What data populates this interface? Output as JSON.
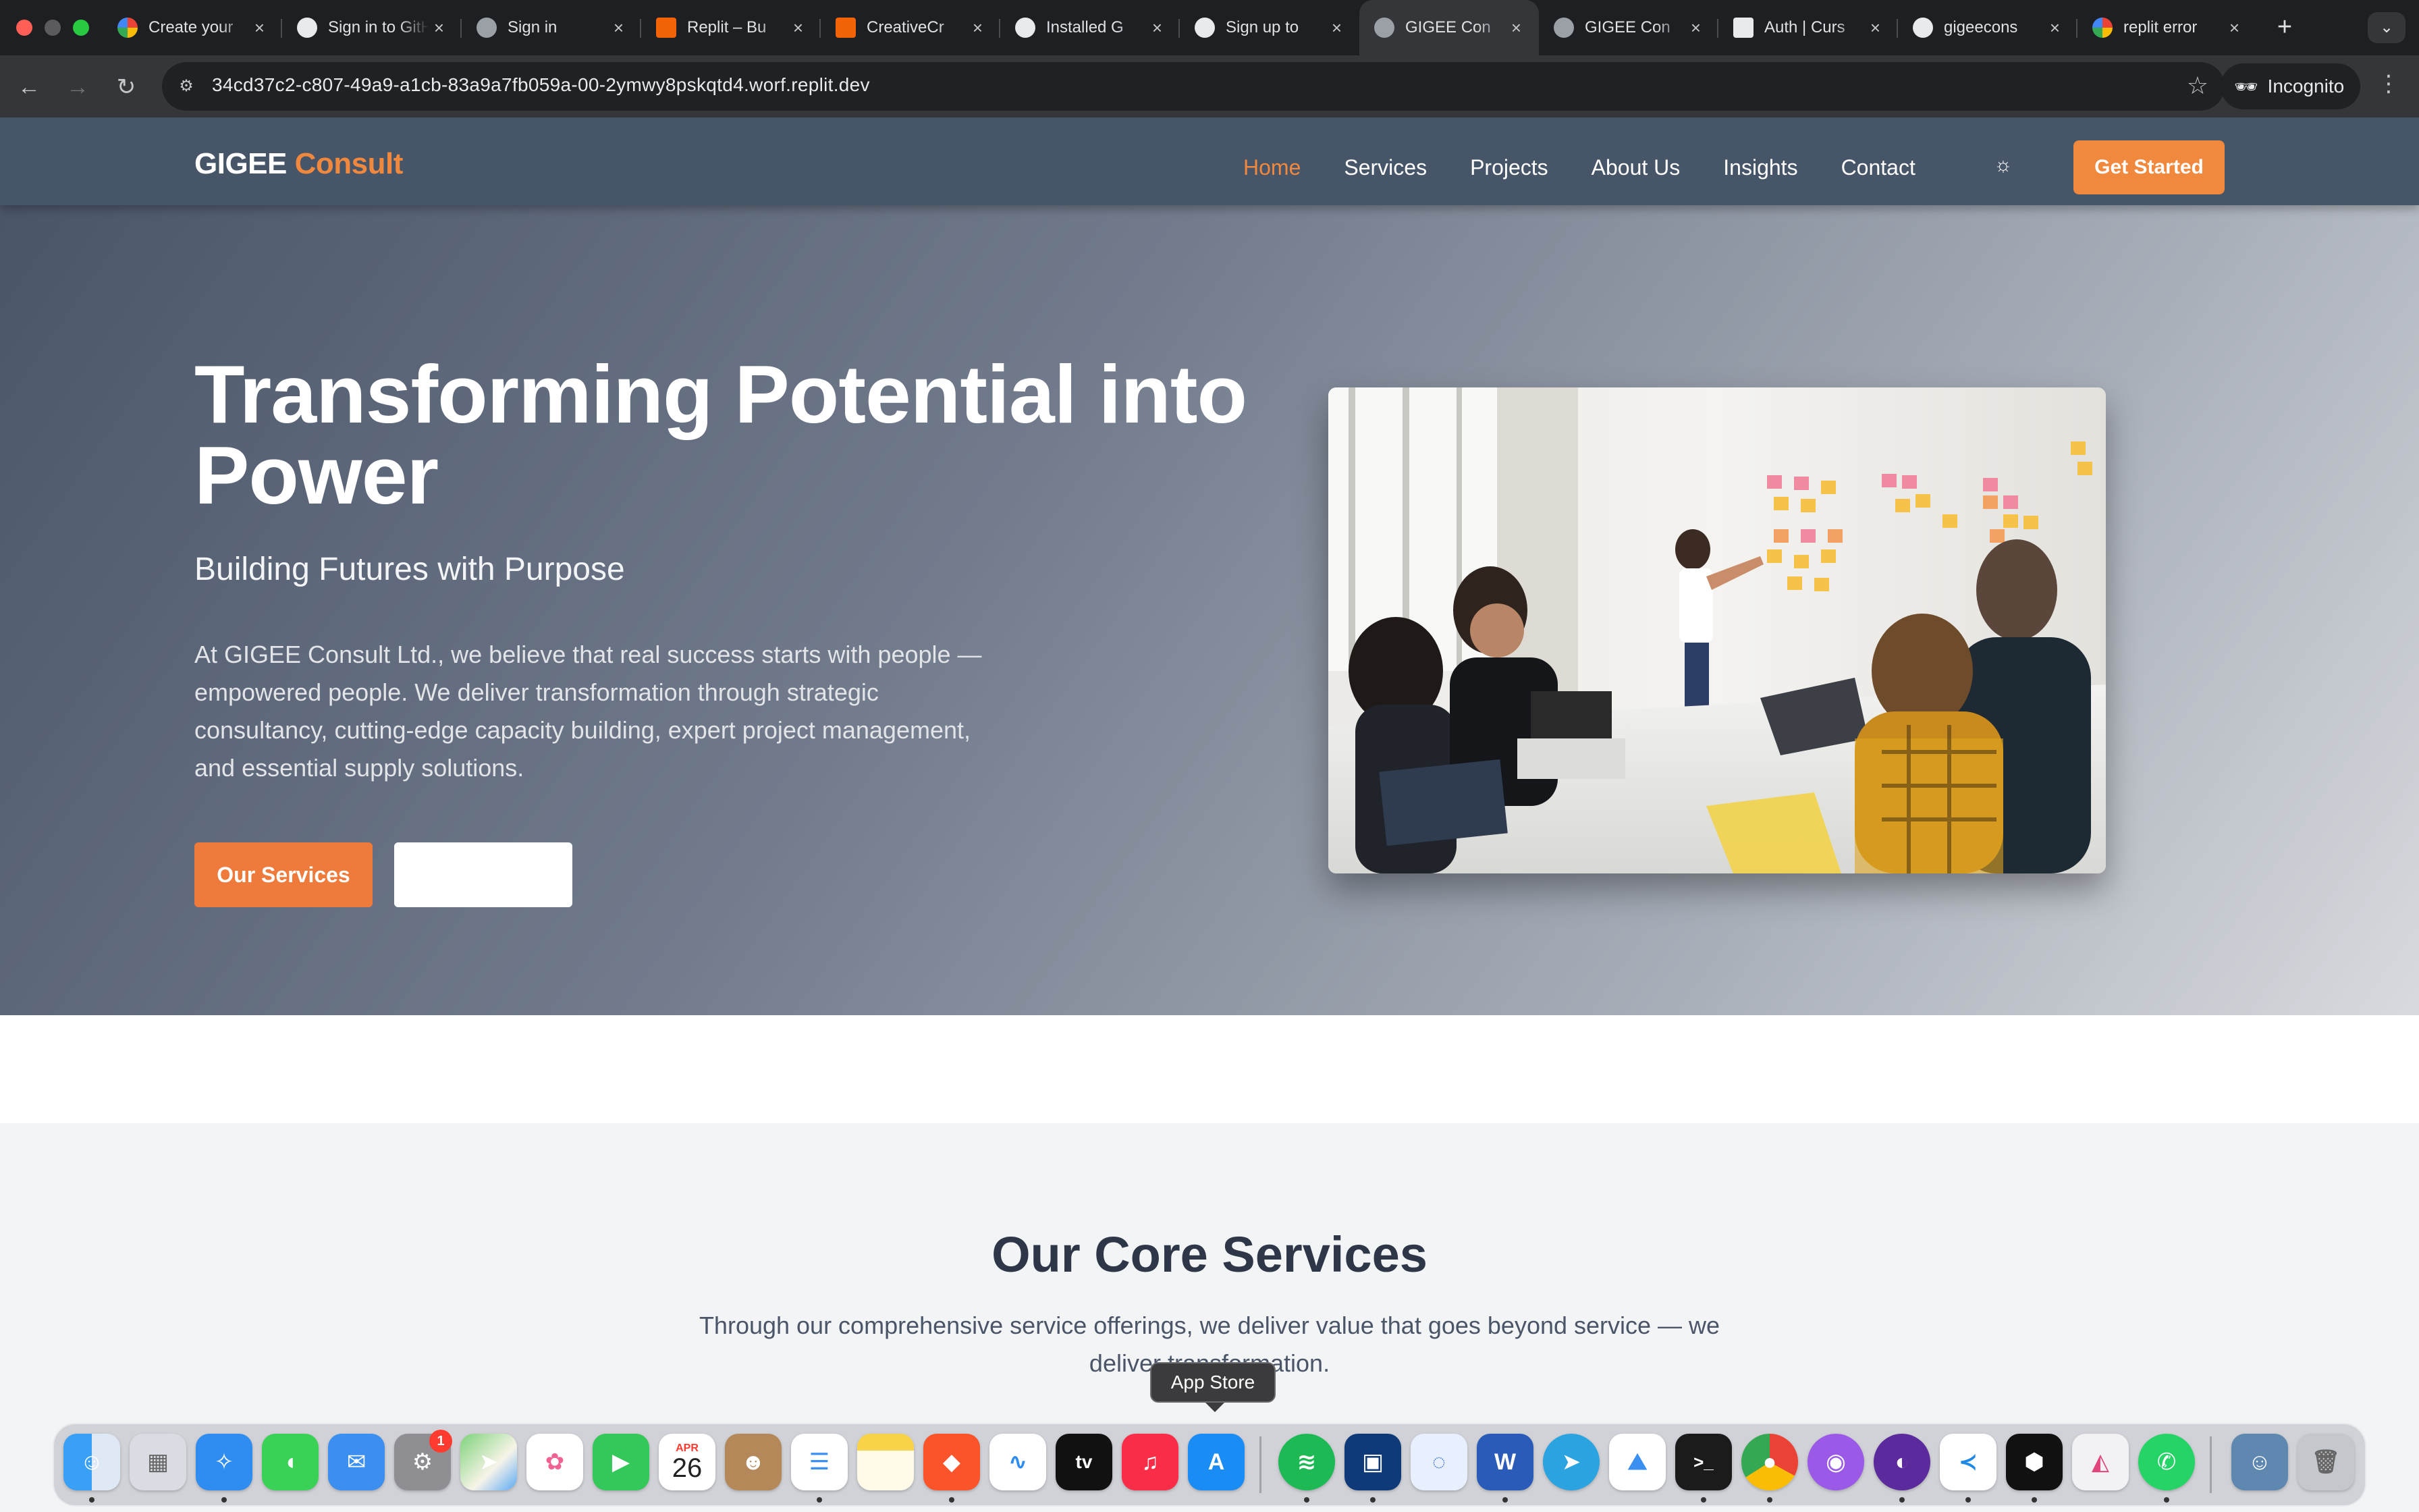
{
  "browser": {
    "tabs": [
      {
        "title": "Create your",
        "favicon": "google-icon"
      },
      {
        "title": "Sign in to GitHub",
        "favicon": "github-icon"
      },
      {
        "title": "Sign in",
        "favicon": "globe-icon"
      },
      {
        "title": "Replit – Bu",
        "favicon": "replit-icon"
      },
      {
        "title": "CreativeCr",
        "favicon": "replit-icon"
      },
      {
        "title": "Installed G",
        "favicon": "github-icon"
      },
      {
        "title": "Sign up to",
        "favicon": "github-icon"
      },
      {
        "title": "GIGEE Con",
        "favicon": "globe-icon",
        "active": true
      },
      {
        "title": "GIGEE Con",
        "favicon": "globe-icon"
      },
      {
        "title": "Auth | Curs",
        "favicon": "cursor-icon"
      },
      {
        "title": "gigeecons",
        "favicon": "github-icon"
      },
      {
        "title": "replit error",
        "favicon": "google-icon"
      }
    ],
    "url": "34cd37c2-c807-49a9-a1cb-83a9a7fb059a-00-2ymwy8pskqtd4.worf.replit.dev",
    "profile_label": "Incognito"
  },
  "site": {
    "logo_main": "GIGEE",
    "logo_accent": "Consult",
    "nav": [
      "Home",
      "Services",
      "Projects",
      "About Us",
      "Insights",
      "Contact"
    ],
    "active_nav": "Home",
    "cta": "Get Started",
    "hero": {
      "title": "Transforming Potential into Power",
      "subtitle": "Building Futures with Purpose",
      "description": "At GIGEE Consult Ltd., we believe that real success starts with people — empowered people. We deliver transformation through strategic consultancy, cutting-edge capacity building, expert project management, and essential supply solutions.",
      "primary_button": "Our Services",
      "secondary_button": ""
    },
    "core": {
      "title": "Our Core Services",
      "description": "Through our comprehensive service offerings, we deliver value that goes beyond service — we deliver transformation."
    },
    "colors": {
      "accent": "#f0883e",
      "nav_bg": "#475569",
      "heading": "#2d3748"
    }
  },
  "dock": {
    "tooltip": "App Store",
    "calendar_month": "APR",
    "calendar_day": "26",
    "settings_badge": "1",
    "apps": [
      "finder",
      "launchpad",
      "safari",
      "messages",
      "mail",
      "system-settings",
      "maps",
      "photos",
      "facetime",
      "calendar",
      "contacts",
      "reminders",
      "notes",
      "brave",
      "freeform",
      "apple-tv",
      "music",
      "app-store",
      "spotify",
      "word-alt",
      "proton",
      "microsoft-word",
      "telegram",
      "macos-app",
      "terminal",
      "chrome",
      "podcasts",
      "tor",
      "vscode",
      "cursor",
      "affinity",
      "whatsapp",
      "user-folder",
      "trash"
    ]
  }
}
